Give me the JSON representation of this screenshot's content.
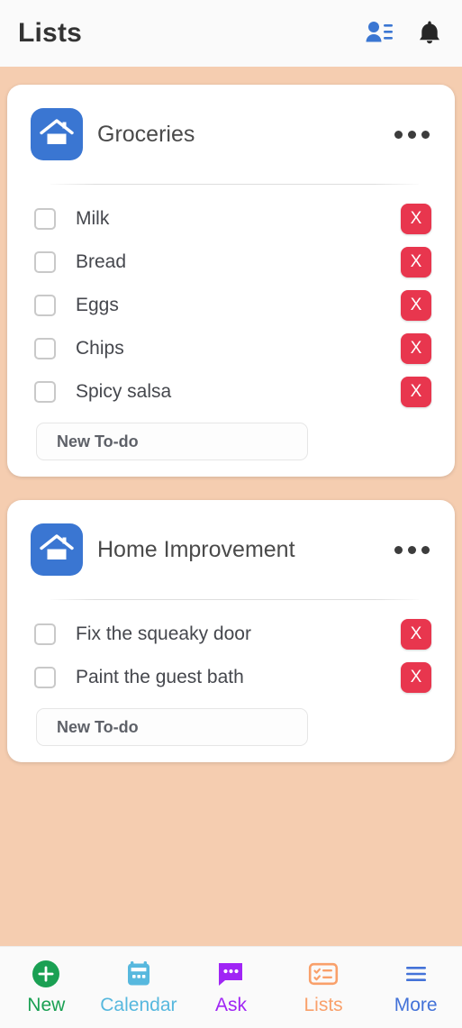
{
  "header": {
    "title": "Lists",
    "contacts_icon": "contacts-person-list-icon",
    "notifications_icon": "bell-icon"
  },
  "lists": [
    {
      "title": "Groceries",
      "avatar_icon": "house-icon",
      "menu_icon": "overflow-menu-icon",
      "new_todo_placeholder": "New To-do",
      "items": [
        {
          "label": "Milk",
          "checked": false,
          "delete_label": "X"
        },
        {
          "label": "Bread",
          "checked": false,
          "delete_label": "X"
        },
        {
          "label": "Eggs",
          "checked": false,
          "delete_label": "X"
        },
        {
          "label": "Chips",
          "checked": false,
          "delete_label": "X"
        },
        {
          "label": "Spicy salsa",
          "checked": false,
          "delete_label": "X"
        }
      ]
    },
    {
      "title": "Home Improvement",
      "avatar_icon": "house-icon",
      "menu_icon": "overflow-menu-icon",
      "new_todo_placeholder": "New To-do",
      "items": [
        {
          "label": "Fix the squeaky door",
          "checked": false,
          "delete_label": "X"
        },
        {
          "label": "Paint the guest bath",
          "checked": false,
          "delete_label": "X"
        }
      ]
    }
  ],
  "tabbar": [
    {
      "label": "New",
      "icon": "plus-circle-icon",
      "color": "#1aa053"
    },
    {
      "label": "Calendar",
      "icon": "calendar-icon",
      "color": "#57b8de"
    },
    {
      "label": "Ask",
      "icon": "chat-bubble-icon",
      "color": "#a025f5"
    },
    {
      "label": "Lists",
      "icon": "checklist-icon",
      "color": "#f9a06a"
    },
    {
      "label": "More",
      "icon": "hamburger-menu-icon",
      "color": "#4372d8"
    }
  ],
  "colors": {
    "background": "#f5cdb0",
    "header_bg": "#fafafa",
    "card_bg": "#ffffff",
    "avatar_blue": "#3a76d2",
    "delete_red": "#e8364e"
  }
}
